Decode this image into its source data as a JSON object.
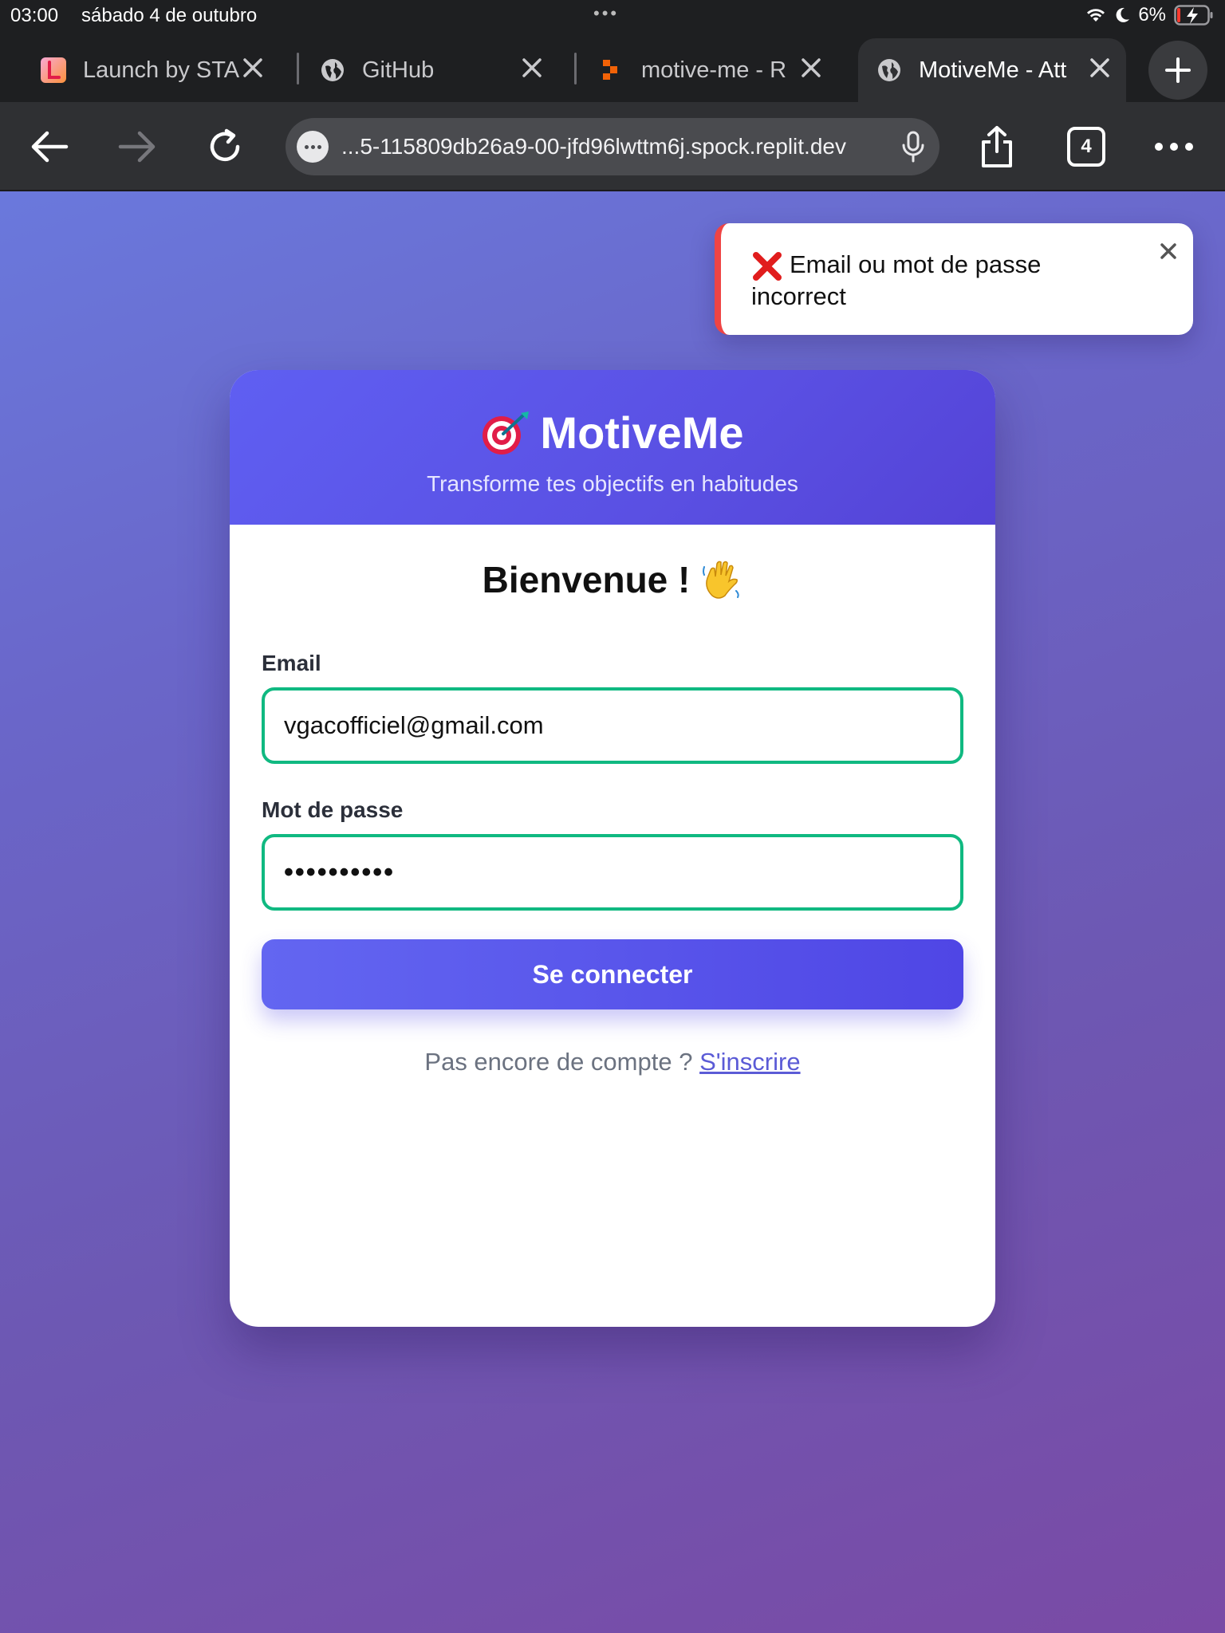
{
  "status_bar": {
    "time": "03:00",
    "date": "sábado 4 de outubro",
    "battery": "6%"
  },
  "tabs": [
    {
      "label": "Launch by STA",
      "icon": "launch-app-icon",
      "active": false
    },
    {
      "label": "GitHub",
      "icon": "globe-icon",
      "active": false
    },
    {
      "label": "motive-me - R",
      "icon": "replit-icon",
      "active": false
    },
    {
      "label": "MotiveMe - Att",
      "icon": "globe-icon",
      "active": true
    }
  ],
  "toolbar": {
    "url": "...5-115809db26a9-00-jfd96lwttm6j.spock.replit.dev",
    "tab_count": "4"
  },
  "toast": {
    "message": "Email ou mot de passe incorrect",
    "accent": "#ef4444"
  },
  "card": {
    "brand": "MotiveMe",
    "tagline": "Transforme tes objectifs en habitudes",
    "welcome": "Bienvenue !",
    "email_label": "Email",
    "email_value": "vgacofficiel@gmail.com",
    "password_label": "Mot de passe",
    "password_value": "••••••••••",
    "submit_label": "Se connecter",
    "signup_prompt": "Pas encore de compte ?",
    "signup_link": "S'inscrire"
  },
  "colors": {
    "header_gradient_start": "#5f5ff2",
    "header_gradient_end": "#5443d6",
    "input_border": "#10b981",
    "button": "#4f46e5"
  }
}
